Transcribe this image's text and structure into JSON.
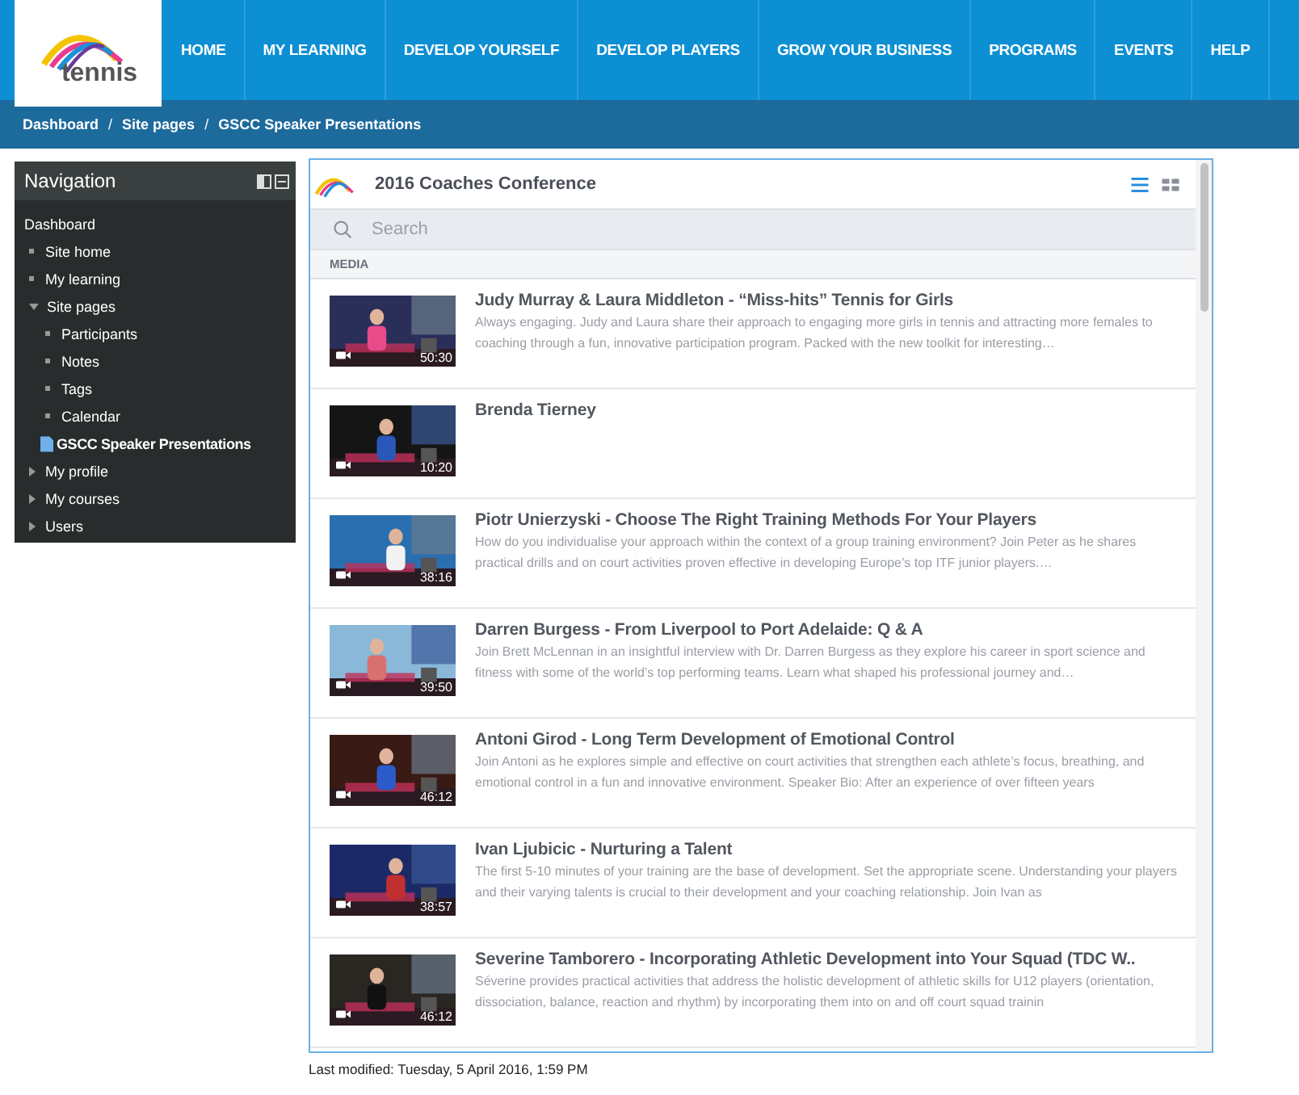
{
  "logo": {
    "text": "tennis"
  },
  "nav": [
    {
      "label": "HOME"
    },
    {
      "label": "MY LEARNING"
    },
    {
      "label": "DEVELOP YOURSELF"
    },
    {
      "label": "DEVELOP PLAYERS"
    },
    {
      "label": "GROW YOUR BUSINESS"
    },
    {
      "label": "PROGRAMS"
    },
    {
      "label": "EVENTS"
    },
    {
      "label": "HELP"
    }
  ],
  "breadcrumb": {
    "separator": "/",
    "items": [
      "Dashboard",
      "Site pages",
      "GSCC Speaker Presentations"
    ]
  },
  "sidebar": {
    "title": "Navigation",
    "items": [
      {
        "label": "Dashboard",
        "kind": "root"
      },
      {
        "label": "Site home",
        "kind": "leaf"
      },
      {
        "label": "My learning",
        "kind": "leaf"
      },
      {
        "label": "Site pages",
        "kind": "branch",
        "expanded": true,
        "children": [
          {
            "label": "Participants",
            "kind": "leaf"
          },
          {
            "label": "Notes",
            "kind": "leaf"
          },
          {
            "label": "Tags",
            "kind": "leaf"
          },
          {
            "label": "Calendar",
            "kind": "leaf"
          },
          {
            "label": "GSCC Speaker Presentations",
            "kind": "page"
          }
        ]
      },
      {
        "label": "My profile",
        "kind": "branch",
        "expanded": false
      },
      {
        "label": "My courses",
        "kind": "branch",
        "expanded": false
      },
      {
        "label": "Users",
        "kind": "branch",
        "expanded": false
      }
    ]
  },
  "gallery": {
    "title": "2016 Coaches Conference",
    "views": [
      {
        "kind": "list",
        "selected": true
      },
      {
        "kind": "grid",
        "selected": false
      }
    ],
    "search": {
      "placeholder": "Search"
    },
    "section": "MEDIA",
    "items": [
      {
        "title": "Judy Murray & Laura Middleton - “Miss-hits” Tennis for Girls",
        "duration": "50:30",
        "description": "Always engaging. Judy and Laura share their approach to engaging more girls in tennis and attracting more females to coaching through a fun, innovative participation program. Packed with the new toolkit for interesting…"
      },
      {
        "title": "Brenda Tierney",
        "duration": "10:20"
      },
      {
        "title": "Piotr Unierzyski - Choose The Right Training Methods For Your Players",
        "duration": "38:16",
        "description": "How do you individualise your approach within the context of a group training environment? Join Peter as he shares practical drills and on court activities proven effective in developing Europe’s top ITF junior players.…"
      },
      {
        "title": "Darren Burgess - From Liverpool to Port Adelaide: Q & A",
        "duration": "39:50",
        "description": "Join Brett McLennan in an insightful interview with Dr. Darren Burgess as they explore his career in sport science and fitness with some of the world’s top performing teams. Learn what shaped his professional journey and…"
      },
      {
        "title": "Antoni Girod - Long Term Development of Emotional Control",
        "duration": "46:12",
        "description": "Join Antoni as he explores simple and effective on court activities that strengthen each athlete’s focus, breathing, and emotional control in a fun and innovative environment. Speaker Bio: After an experience of over fifteen years"
      },
      {
        "title": "Ivan Ljubicic - Nurturing a Talent",
        "duration": "38:57",
        "description": "The first 5-10 minutes of your training are the base of development. Set the appropriate scene. Understanding your players and their varying talents is crucial to their development and your coaching relationship. Join Ivan as"
      },
      {
        "title": "Severine Tamborero - Incorporating Athletic Development into Your Squad (TDC W..",
        "duration": "46:12",
        "description": "Séverine provides practical activities that address the holistic development of athletic skills for U12 players (orientation, dissociation, balance, reaction and rhythm) by incorporating them into on and off court squad trainin"
      }
    ]
  },
  "footer": "Last modified: Tuesday, 5 April 2016, 1:59 PM"
}
